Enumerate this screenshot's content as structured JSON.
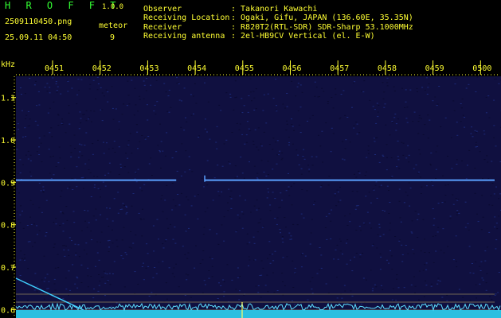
{
  "header": {
    "app_title": "H R O F F T",
    "version": "1.0.0",
    "filename": "2509110450.png",
    "datetime": "25.09.11 04:50",
    "detector_label": "meteor",
    "meteor_count": "9",
    "info": [
      {
        "label": "Observer",
        "value": ": Takanori Kawachi"
      },
      {
        "label": "Receiving Location",
        "value": ": Ogaki, Gifu, JAPAN (136.60E, 35.35N)"
      },
      {
        "label": "Receiver",
        "value": ": R820T2(RTL-SDR) SDR-Sharp 53.1000MHz"
      },
      {
        "label": "Receiving antenna",
        "value": ": 2el-HB9CV Vertical (el. E-W)"
      }
    ]
  },
  "spectrogram": {
    "y_unit": "kHz",
    "time_ticks": [
      "0451",
      "0452",
      "0453",
      "0454",
      "0455",
      "0456",
      "0457",
      "0458",
      "0459",
      "0500"
    ],
    "freq_ticks": [
      "1.1",
      "1.0",
      "0.9",
      "0.8",
      "0.7",
      "0.6"
    ],
    "freq_tick_values": [
      1.1,
      1.0,
      0.9,
      0.8,
      0.7,
      0.6
    ],
    "y_range_khz": [
      0.58,
      1.15
    ],
    "carrier_khz": 0.905,
    "carrier_gap_minutes": [
      3.6,
      4.2
    ],
    "colors": {
      "background": "#101040",
      "carrier": "#5aa0ff",
      "signal": "#40d0ff",
      "axis": "#ffff33",
      "guide": "#b0a060"
    }
  }
}
